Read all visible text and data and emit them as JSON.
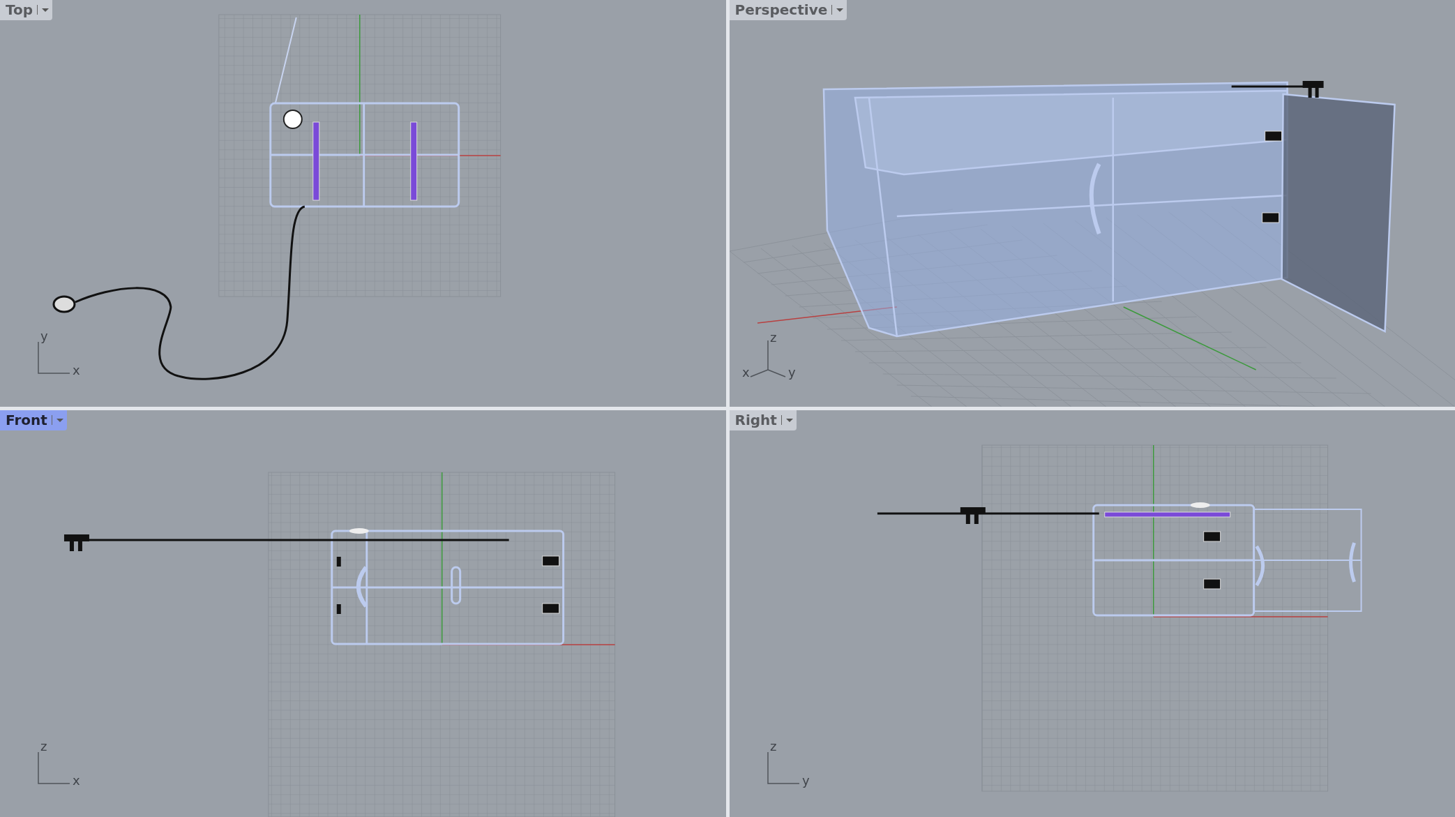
{
  "viewports": [
    {
      "kind": "top",
      "title": "Top",
      "selected": false,
      "axis_labels": [
        "y",
        "x"
      ]
    },
    {
      "kind": "perspective",
      "title": "Perspective",
      "selected": false,
      "axis_labels": [
        "z",
        "x",
        "y"
      ]
    },
    {
      "kind": "front",
      "title": "Front",
      "selected": true,
      "axis_labels": [
        "z",
        "x"
      ]
    },
    {
      "kind": "right",
      "title": "Right",
      "selected": false,
      "axis_labels": [
        "z",
        "y"
      ]
    }
  ]
}
